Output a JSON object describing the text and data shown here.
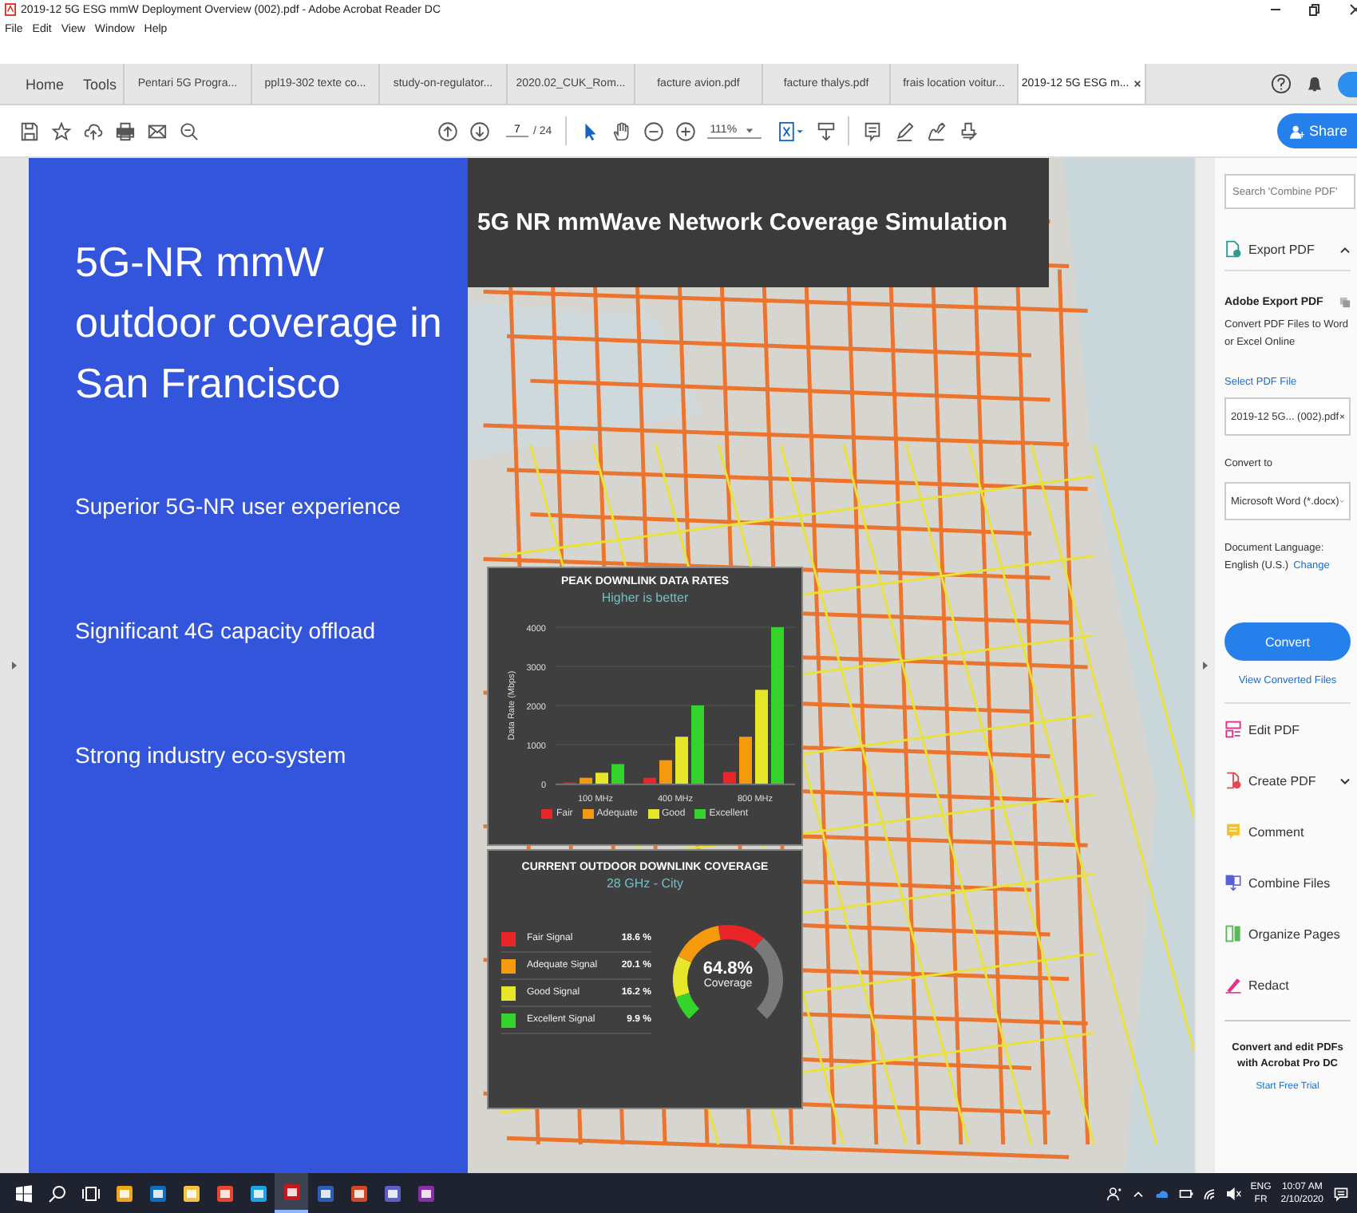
{
  "window": {
    "title": "2019-12 5G ESG mmW Deployment Overview (002).pdf - Adobe Acrobat Reader DC"
  },
  "menu": [
    "File",
    "Edit",
    "View",
    "Window",
    "Help"
  ],
  "nav": [
    {
      "label": "Home",
      "selected": false
    },
    {
      "label": "Tools",
      "selected": false
    }
  ],
  "tabs": [
    {
      "label": "Pentari 5G  Progra...",
      "selected": false
    },
    {
      "label": "ppl19-302 texte co...",
      "selected": false
    },
    {
      "label": "study-on-regulator...",
      "selected": false
    },
    {
      "label": "2020.02_CUK_Rom...",
      "selected": false
    },
    {
      "label": "facture avion.pdf",
      "selected": false
    },
    {
      "label": "facture thalys.pdf",
      "selected": false
    },
    {
      "label": "frais location voitur...",
      "selected": false
    },
    {
      "label": "2019-12 5G ESG m...",
      "selected": true
    }
  ],
  "toolbar": {
    "page": "7",
    "page_total": "/ 24",
    "zoom": "111%",
    "share": "Share"
  },
  "slide": {
    "heading": "5G-NR mmW outdoor coverage in San Francisco",
    "bullets": [
      "Superior 5G-NR user experience",
      "Significant 4G capacity offload",
      "Strong industry eco-system"
    ],
    "map_title": "5G NR mmWave Network Coverage Simulation"
  },
  "rate_panel": {
    "title": "PEAK DOWNLINK DATA RATES",
    "subtitle": "Higher is better",
    "chart_data": {
      "type": "bar",
      "grid": true,
      "ylabel": "Data Rate (Mbps)",
      "categories": [
        "100 MHz",
        "400 MHz",
        "800 MHz"
      ],
      "ylim": [
        0,
        4000
      ],
      "yticks": [
        0,
        1000,
        2000,
        3000,
        4000
      ],
      "series": [
        {
          "name": "Fair",
          "color": "#e8262a",
          "values": [
            30,
            150,
            300
          ]
        },
        {
          "name": "Adequate",
          "color": "#f59a0c",
          "values": [
            150,
            600,
            1200
          ]
        },
        {
          "name": "Good",
          "color": "#e6e62a",
          "values": [
            280,
            1200,
            2400
          ]
        },
        {
          "name": "Excellent",
          "color": "#35d42c",
          "values": [
            500,
            2000,
            4000
          ]
        }
      ]
    }
  },
  "coverage_panel": {
    "title": "CURRENT OUTDOOR DOWNLINK COVERAGE",
    "subtitle": "28 GHz - City",
    "signals": [
      {
        "label": "Fair Signal",
        "value": "18.6 %",
        "color": "#e8262a"
      },
      {
        "label": "Adequate Signal",
        "value": "20.1 %",
        "color": "#f59a0c"
      },
      {
        "label": "Good Signal",
        "value": "16.2 %",
        "color": "#e6e62a"
      },
      {
        "label": "Excellent Signal",
        "value": "9.9 %",
        "color": "#35d42c"
      }
    ],
    "gauge_value": "64.8%",
    "gauge_label": "Coverage"
  },
  "right_panel": {
    "search_placeholder": "Search 'Combine PDF'",
    "export": {
      "label": "Export PDF",
      "expanded": true
    },
    "heading": "Adobe Export PDF",
    "description": "Convert PDF Files to Word or Excel Online",
    "select_label": "Select PDF File",
    "file": "2019-12 5G... (002).pdf",
    "convert_to_label": "Convert to",
    "format": "Microsoft Word (*.docx)",
    "language_label": "Document Language:",
    "language": "English (U.S.)",
    "change": "Change",
    "convert": "Convert",
    "view_converted": "View Converted Files",
    "tools": [
      {
        "label": "Edit PDF",
        "kind": "edit",
        "has_menu": false
      },
      {
        "label": "Create PDF",
        "kind": "create",
        "has_menu": true
      },
      {
        "label": "Comment",
        "kind": "comment",
        "has_menu": false
      },
      {
        "label": "Combine Files",
        "kind": "combine",
        "has_menu": false
      },
      {
        "label": "Organize Pages",
        "kind": "organize",
        "has_menu": false
      },
      {
        "label": "Redact",
        "kind": "redact",
        "has_menu": false
      }
    ],
    "promo": "Convert and edit PDFs with Acrobat Pro DC",
    "trial": "Start Free Trial"
  },
  "taskbar": {
    "apps": [
      {
        "kind": "start",
        "selected": false
      },
      {
        "kind": "search",
        "selected": false
      },
      {
        "kind": "taskview",
        "selected": false
      },
      {
        "kind": "app",
        "color": "#f2a516",
        "selected": false
      },
      {
        "kind": "app",
        "color": "#0f6cbd",
        "selected": false
      },
      {
        "kind": "app",
        "color": "#f5c542",
        "selected": false
      },
      {
        "kind": "app",
        "color": "#e8452c",
        "selected": false
      },
      {
        "kind": "app",
        "color": "#1aa3e8",
        "selected": false
      },
      {
        "kind": "app",
        "color": "#c8161d",
        "selected": true
      },
      {
        "kind": "app",
        "color": "#2b5eb8",
        "selected": false
      },
      {
        "kind": "app",
        "color": "#d24726",
        "selected": false
      },
      {
        "kind": "app",
        "color": "#5b5fc7",
        "selected": false
      },
      {
        "kind": "app",
        "color": "#8b2fa8",
        "selected": false
      }
    ],
    "lang": "ENG",
    "lang2": "FR",
    "time": "10:07 AM",
    "date": "2/10/2020"
  }
}
